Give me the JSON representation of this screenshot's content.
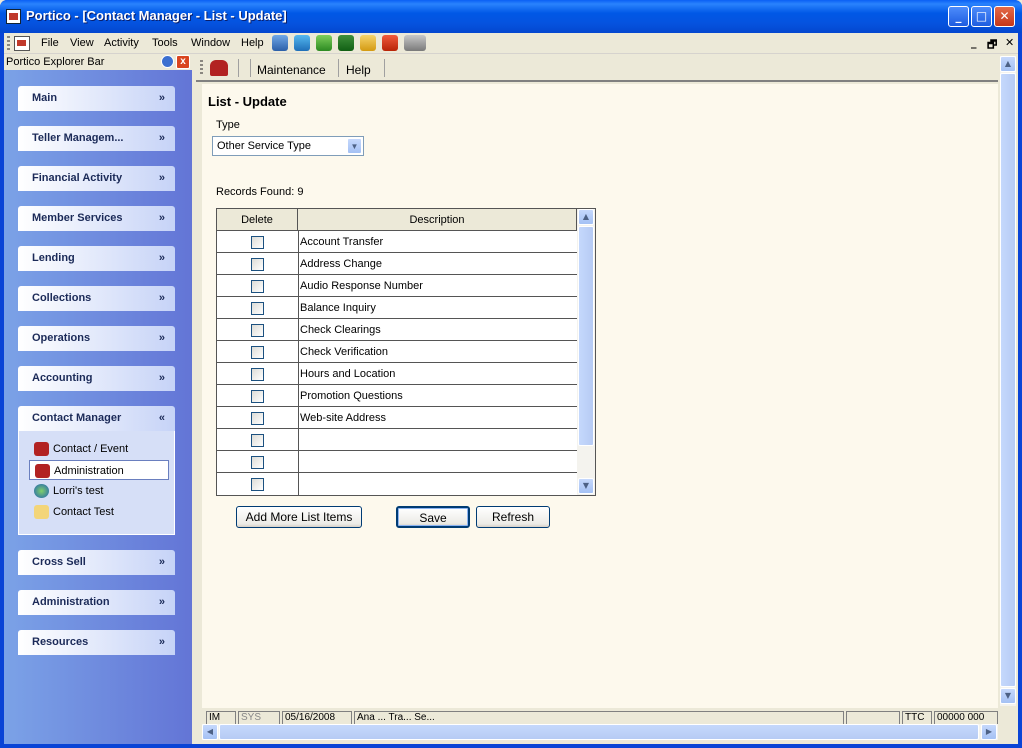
{
  "window": {
    "title": "Portico - [Contact Manager - List - Update]",
    "minimize": "_",
    "maximize": "□",
    "close": "✕"
  },
  "menubar": {
    "items": [
      "File",
      "View",
      "Activity",
      "Tools",
      "Window",
      "Help"
    ],
    "mdi_min": "_",
    "mdi_restore": "🗗",
    "mdi_close": "✕"
  },
  "explorer": {
    "title": "Portico Explorer Bar",
    "groups": [
      {
        "label": "Main",
        "chevron": "»"
      },
      {
        "label": "Teller Managem...",
        "chevron": "»"
      },
      {
        "label": "Financial Activity",
        "chevron": "»"
      },
      {
        "label": "Member Services",
        "chevron": "»"
      },
      {
        "label": "Lending",
        "chevron": "»"
      },
      {
        "label": "Collections",
        "chevron": "»"
      },
      {
        "label": "Operations",
        "chevron": "»"
      },
      {
        "label": "Accounting",
        "chevron": "»"
      },
      {
        "label": "Contact Manager",
        "chevron": "«"
      },
      {
        "label": "Cross Sell",
        "chevron": "»"
      },
      {
        "label": "Administration",
        "chevron": "»"
      },
      {
        "label": "Resources",
        "chevron": "»"
      }
    ],
    "contact_items": [
      "Contact / Event",
      "Administration",
      "Lorri's test",
      "Contact Test"
    ]
  },
  "subtoolbar": {
    "maintenance": "Maintenance",
    "help": "Help"
  },
  "page": {
    "title": "List - Update",
    "type_label": "Type",
    "type_value": "Other Service Type",
    "records_label": "Records Found:",
    "records_count": "9",
    "col_delete": "Delete",
    "col_description": "Description",
    "rows": [
      "Account Transfer",
      "Address Change",
      "Audio Response Number",
      "Balance Inquiry",
      "Check Clearings",
      "Check Verification",
      "Hours and Location",
      "Promotion Questions",
      "Web-site  Address",
      "",
      "",
      ""
    ],
    "btn_add": "Add More List Items",
    "btn_save": "Save",
    "btn_refresh": "Refresh"
  },
  "status": {
    "panels": [
      "IM",
      "SYS",
      "05/16/2008",
      "Ana ... Tra... Se...",
      "",
      "TTC",
      "00000 000"
    ]
  }
}
